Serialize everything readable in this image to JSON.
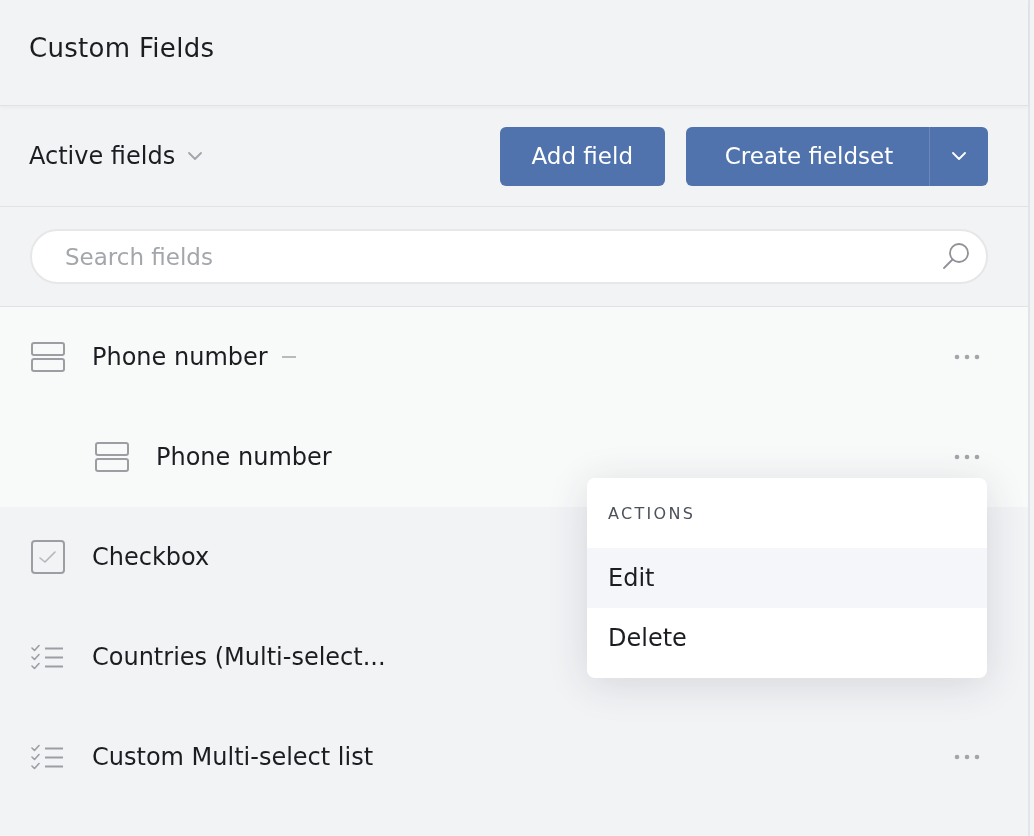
{
  "header": {
    "title": "Custom Fields"
  },
  "toolbar": {
    "filter": {
      "label": "Active fields"
    },
    "buttons": [
      {
        "label": "Add field",
        "kind": "plain"
      },
      {
        "label": "Create fieldset",
        "kind": "split"
      }
    ]
  },
  "search": {
    "placeholder": "Search fields"
  },
  "fields": [
    {
      "name": "Phone number",
      "kind": "stacked",
      "expanded": true,
      "children": [
        {
          "name": "Phone number",
          "kind": "stacked",
          "menu": {
            "title": "ACTIONS",
            "items": [
              {
                "label": "Edit",
                "selected": true
              },
              {
                "label": "Delete",
                "selected": false
              }
            ]
          }
        }
      ]
    },
    {
      "name": "Checkbox",
      "kind": "checkbox"
    },
    {
      "name": "Countries (Multi-select...",
      "kind": "checklist"
    },
    {
      "name": "Custom Multi-select list",
      "kind": "checklist"
    }
  ]
}
